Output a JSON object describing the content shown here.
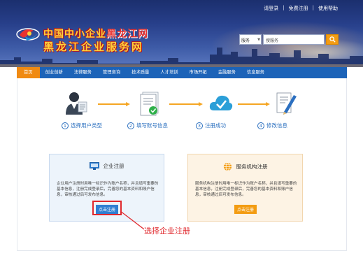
{
  "toplinks": {
    "login": "请登录",
    "register": "免费注册",
    "help": "使用帮助"
  },
  "site": {
    "title_line1_a": "中国中小企业",
    "title_line1_b": "黑龙江网",
    "title_line2": "黑龙江企业服务网"
  },
  "search": {
    "scope": "服务",
    "placeholder": "搜服务"
  },
  "nav": [
    "首页",
    "创业创新",
    "法律服务",
    "管理咨询",
    "技术质量",
    "人才培训",
    "市场开拓",
    "金融服务",
    "信息服务"
  ],
  "steps": [
    {
      "num": "1",
      "label": "选择用户类型"
    },
    {
      "num": "2",
      "label": "填写账号信息"
    },
    {
      "num": "3",
      "label": "注册成功"
    },
    {
      "num": "4",
      "label": "修改信息"
    }
  ],
  "enterprise": {
    "title": "企业注册",
    "desc": "企业用户注册时用唯一标识作为账户名称，并且填写重要的基本信息，注册完成登录后，完善您的基本资料和账户信息，审核通过后可发布信息。",
    "button": "点击注册"
  },
  "service": {
    "title": "服务机构注册",
    "desc": "服务机构注册时用唯一标识作为账户名称，并且填写重要的基本信息，注册完成登录后，完善您的基本资料和账户信息，审核通过后可发布信息。",
    "button": "点击注册"
  },
  "annotation": "选择企业注册",
  "colors": {
    "nav": "#1c63b8",
    "active": "#f08a12",
    "accent_blue": "#2a6fbf",
    "annotation": "#e0282d"
  }
}
